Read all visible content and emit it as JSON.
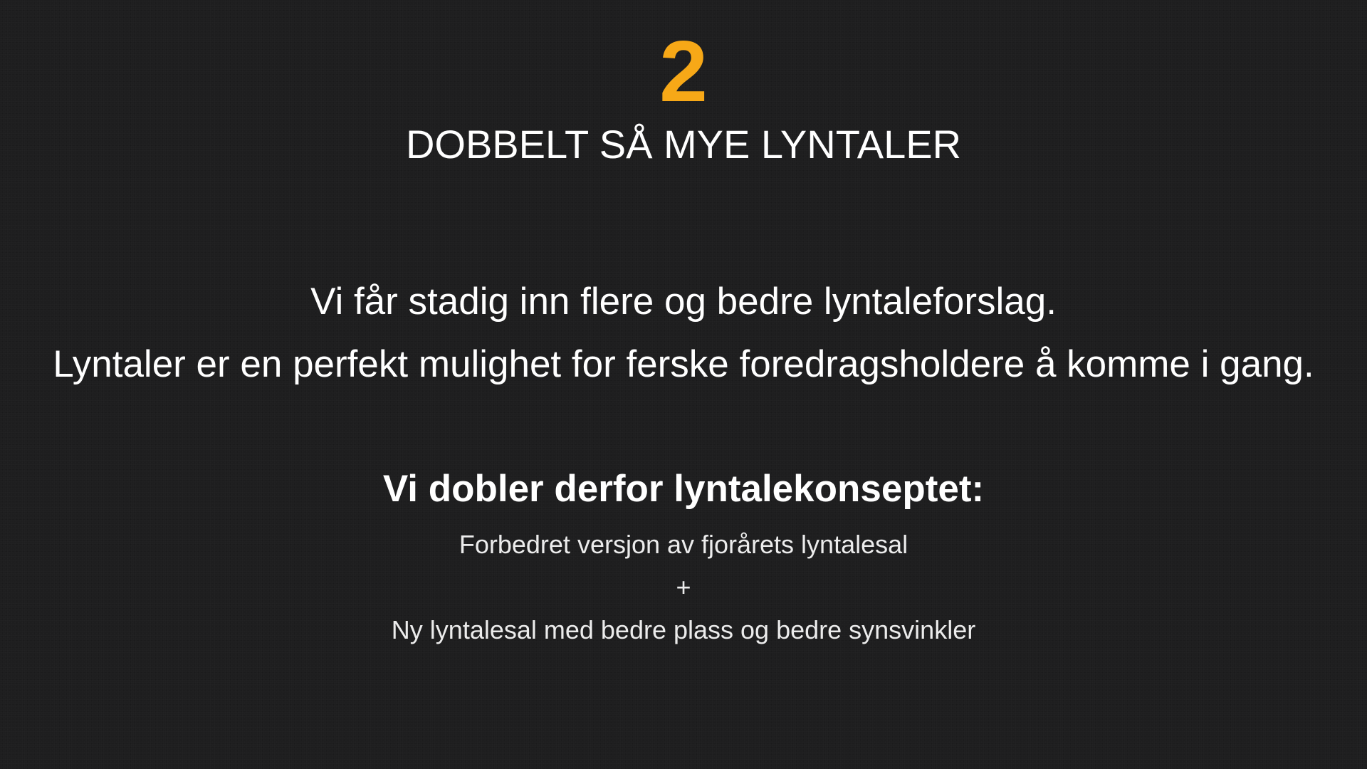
{
  "slide": {
    "number": "2",
    "title": "DOBBELT SÅ MYE LYNTALER",
    "intro_lines": [
      "Vi får stadig inn flere og bedre lyntaleforslag.",
      "Lyntaler er en perfekt mulighet for ferske foredragsholdere å komme i gang."
    ],
    "highlight": "Vi dobler derfor lyntalekonseptet:",
    "details": [
      "Forbedret versjon av fjorårets lyntalesal",
      "+",
      "Ny lyntalesal med bedre plass og bedre synsvinkler"
    ]
  },
  "colors": {
    "background": "#1e1e1f",
    "accent": "#f7a817",
    "text": "#ffffff"
  }
}
